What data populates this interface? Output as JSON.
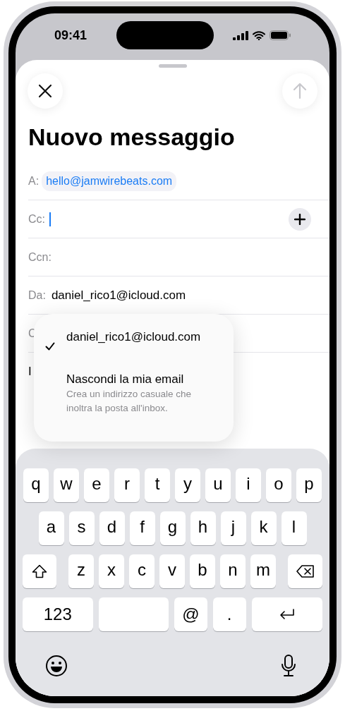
{
  "status_bar": {
    "time": "09:41"
  },
  "compose": {
    "send_disabled": true,
    "title": "Nuovo messaggio",
    "fields": [
      {
        "kind": "recipient",
        "label": "A:",
        "token": "hello@jamwirebeats.com"
      },
      {
        "kind": "cursor",
        "label": "Cc:"
      },
      {
        "kind": "text",
        "label": "Ccn:"
      },
      {
        "kind": "text",
        "label": "Da:",
        "value": "daniel_rico1@icloud.com"
      },
      {
        "kind": "text",
        "label": "C"
      },
      {
        "kind": "subject",
        "label": "I"
      }
    ]
  },
  "from_menu": {
    "options": [
      {
        "title": "daniel_rico1@icloud.com",
        "selected": true
      },
      {
        "title": "Nascondi la mia email",
        "description": "Crea un indirizzo casuale che inoltra la posta all'inbox.",
        "selected": false
      }
    ]
  },
  "keyboard": {
    "rows": [
      [
        "q",
        "w",
        "e",
        "r",
        "t",
        "y",
        "u",
        "i",
        "o",
        "p"
      ],
      [
        "a",
        "s",
        "d",
        "f",
        "g",
        "h",
        "j",
        "k",
        "l"
      ],
      [
        "z",
        "x",
        "c",
        "v",
        "b",
        "n",
        "m"
      ]
    ],
    "bottom": [
      {
        "kind": "mode",
        "label": "123"
      },
      {
        "kind": "space"
      },
      {
        "kind": "char",
        "label": "@"
      },
      {
        "kind": "char",
        "label": "."
      },
      {
        "kind": "return"
      }
    ]
  }
}
